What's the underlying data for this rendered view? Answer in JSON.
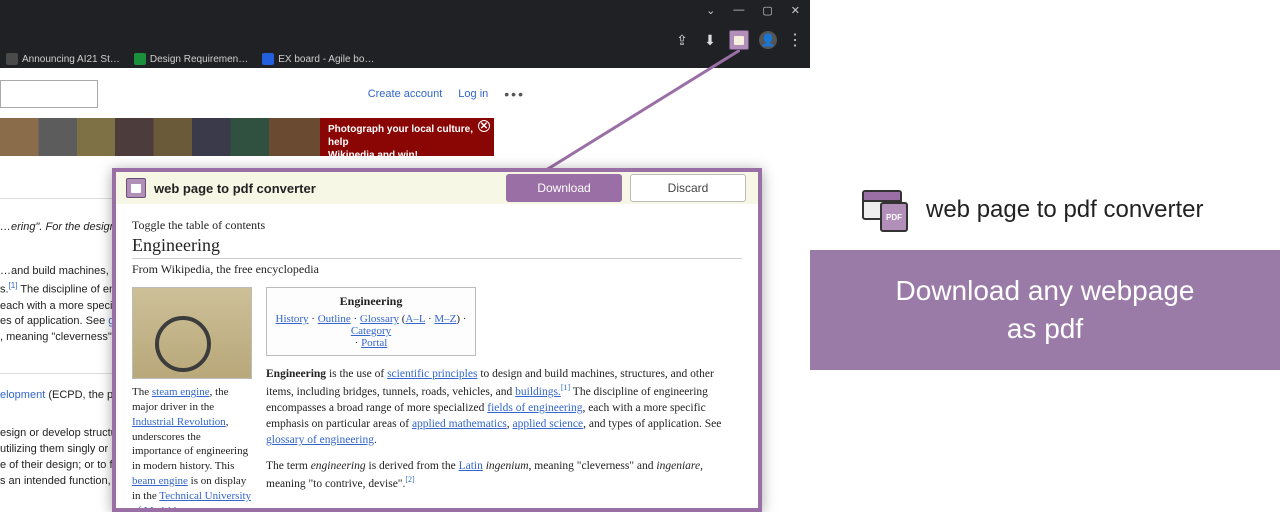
{
  "chrome": {
    "win_min": "—",
    "win_max": "▢",
    "win_close": "✕",
    "chev_down": "⌄",
    "share": "⇪",
    "down": "⬇"
  },
  "bookmarks": {
    "b1": "Announcing AI21 St…",
    "b2": "Design Requiremen…",
    "b3": "EX board - Agile bo…"
  },
  "wiki": {
    "create_account": "Create account",
    "login": "Log in",
    "dots": "•••",
    "banner_line1": "Photograph your local culture, help",
    "banner_line2": "Wikipedia and win!",
    "italic_note": "…ering\". For the design and buil…",
    "p1": "…and build machines, structure…",
    "p2_prefix": "s.",
    "p2_sup": "[1]",
    "p2_rest": " The discipline of engineer…",
    "p3": "each with a more specific empl…",
    "p4_prefix": "es of application. See ",
    "p4_link": "glossary",
    "p5": ", meaning \"cleverness\" and in…",
    "ecpd_link": "elopment",
    "ecpd_rest": " (ECPD, the predece…",
    "para2_a": "esign or develop structures, m…",
    "para2_b": "utilizing them singly or in com…",
    "para2_c": "e of their design; or to forecast…",
    "para2_d": "s an intended function, econon…"
  },
  "popup": {
    "title": "web page to pdf converter",
    "download": "Download",
    "discard": "Discard",
    "toc": "Toggle the table of contents",
    "h1": "Engineering",
    "subtitle": "From Wikipedia, the free encyclopedia",
    "infobox_title": "Engineering",
    "ibox_history": "History",
    "ibox_outline": "Outline",
    "ibox_glossary": "Glossary",
    "ibox_al": "A–L",
    "ibox_mz": "M–Z",
    "ibox_category": "Category",
    "ibox_portal": "Portal",
    "sep": " · ",
    "cap_pre1": "The ",
    "cap_link1": "steam engine",
    "cap_post1": ", the major driver in the ",
    "cap_link2": "Industrial Revolution",
    "cap_post2": ", underscores the importance of engineering in modern history. This ",
    "cap_link3": "beam engine",
    "cap_post3": " is on display in the ",
    "cap_link4": "Technical University of Madrid",
    "cap_end": ".",
    "art_b1": "Engineering",
    "art_t1": " is the use of ",
    "art_l1": "scientific principles",
    "art_t2": " to design and build machines, structures, and other items, including bridges, tunnels, roads, vehicles, and ",
    "art_l2": "buildings.",
    "art_sup1": "[1]",
    "art_t3": " The discipline of engineering encompasses a broad range of more specialized ",
    "art_l3": "fields of engineering",
    "art_t4": ", each with a more specific emphasis on particular areas of ",
    "art_l4": "applied mathematics",
    "art_c": ", ",
    "art_l5": "applied science",
    "art_t5": ", and types of application. See ",
    "art_l6": "glossary of engineering",
    "art_dot": ".",
    "art2_t1": "The term ",
    "art2_i1": "engineering",
    "art2_t2": " is derived from the ",
    "art2_l1": "Latin",
    "art2_sp": " ",
    "art2_i2": "ingenium",
    "art2_t3": ", meaning \"cleverness\" and ",
    "art2_i3": "ingeniare",
    "art2_t4": ", meaning \"to contrive, devise\".",
    "art2_sup": "[2]"
  },
  "right": {
    "brand": "web page to pdf converter",
    "tagline1": "Download any webpage",
    "tagline2": "as pdf"
  }
}
